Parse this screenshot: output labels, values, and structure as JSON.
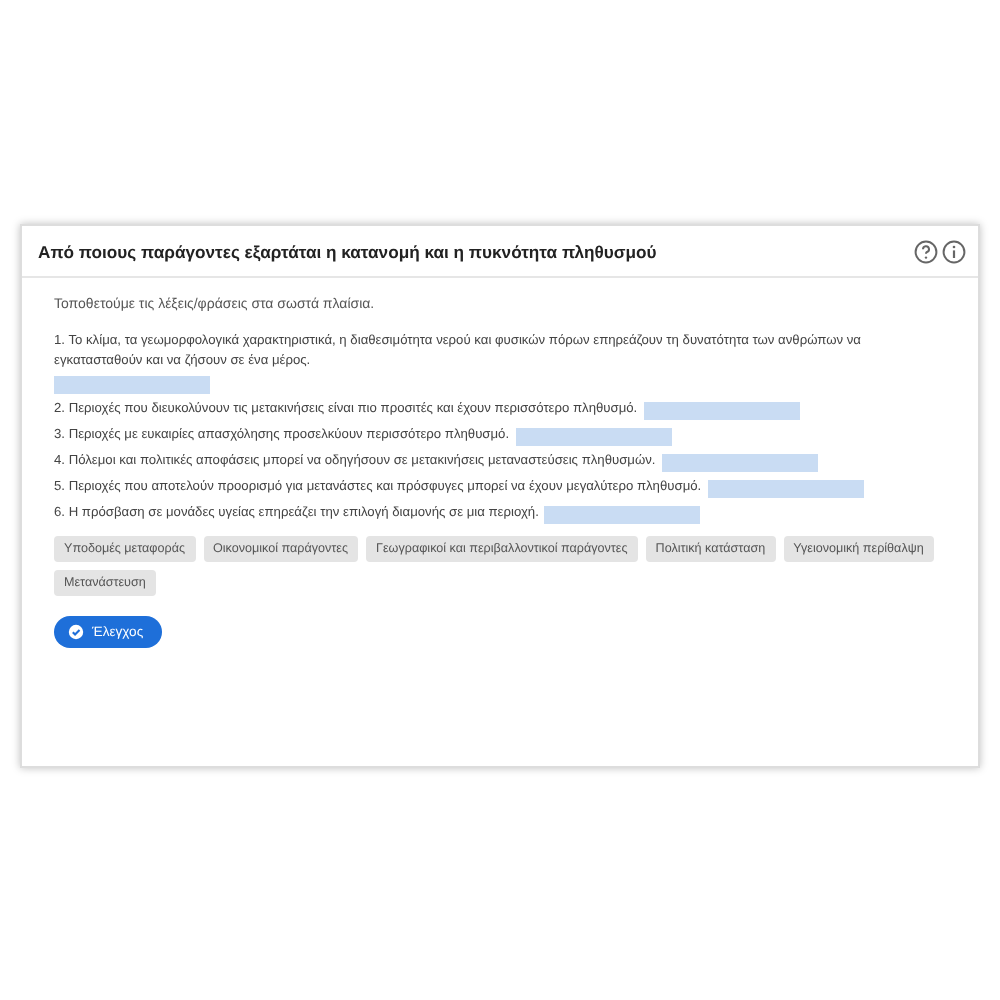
{
  "title": "Από ποιους παράγοντες εξαρτάται η κατανομή και η πυκνότητα πληθυσμού",
  "instruction": "Τοποθετούμε τις λέξεις/φράσεις στα σωστά πλαίσια.",
  "sentences": [
    {
      "text": "1. Το κλίμα, τα γεωμορφολογικά χαρακτηριστικά, η διαθεσιμότητα νερού και φυσικών πόρων επηρεάζουν τη δυνατότητα των ανθρώπων να εγκατασταθούν και να ζήσουν σε ένα μέρος."
    },
    {
      "text": "2. Περιοχές που διευκολύνουν τις μετακινήσεις είναι πιο προσιτές και έχουν περισσότερο πληθυσμό."
    },
    {
      "text": "3. Περιοχές με ευκαιρίες απασχόλησης προσελκύουν περισσότερο πληθυσμό."
    },
    {
      "text": "4. Πόλεμοι και πολιτικές αποφάσεις μπορεί να οδηγήσουν σε μετακινήσεις μεταναστεύσεις πληθυσμών."
    },
    {
      "text": "5. Περιοχές που αποτελούν προορισμό για μετανάστες και πρόσφυγες μπορεί να έχουν μεγαλύτερο πληθυσμό."
    },
    {
      "text": "6. Η πρόσβαση σε μονάδες υγείας επηρεάζει την επιλογή διαμονής σε μια περιοχή."
    }
  ],
  "options": [
    "Υποδομές μεταφοράς",
    "Οικονομικοί παράγοντες",
    "Γεωγραφικοί και περιβαλλοντικοί παράγοντες",
    "Πολιτική κατάσταση",
    "Υγειονομική περίθαλψη",
    "Μετανάστευση"
  ],
  "check_button": "Έλεγχος"
}
